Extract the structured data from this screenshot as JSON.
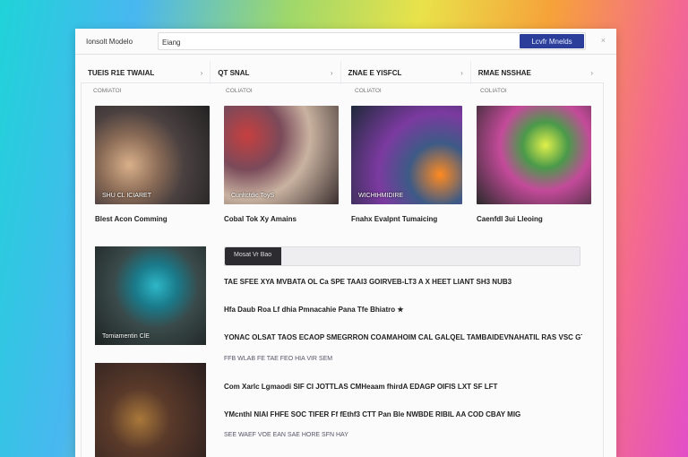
{
  "window": {
    "site_label": "Ionsolt Modelo",
    "site_field": "Eiang",
    "go_button": "Lcvfr Mnelds",
    "close_glyph": "×"
  },
  "chips": [
    {
      "label": "TUEIS R1E TWAIAL"
    },
    {
      "label": "QT SNAL"
    },
    {
      "label": "ZNAE E YISFCL"
    },
    {
      "label": "RMAE NSSHAE"
    }
  ],
  "sections": [
    "COMIATOI",
    "COLIATOI",
    "COLIATOI",
    "COLIATOI"
  ],
  "cards": [
    {
      "overlay": "SHU CL ICIARET",
      "caption": "Blest Acon Comming"
    },
    {
      "overlay": "Cunltctdic ToyS",
      "caption": "Cobal Tok Xy Amains"
    },
    {
      "overlay": "WICHtHMIDIRE",
      "caption": "Fnahx Evalpnt Tumaicing"
    },
    {
      "overlay": "",
      "caption": "Caenfdl 3ui Lleoing"
    }
  ],
  "big_thumbs": [
    {
      "overlay": "Tomiamentin ClE"
    },
    {
      "overlay": ""
    }
  ],
  "progress": {
    "label": "Mosat Vr Bao",
    "value": 0.16
  },
  "rows": [
    {
      "text": "TAE SFEE XYA MVBATA OL Ca SPE TAAI3 GOIRVEB-LT3  A  X  HEET LIANT SH3 NUB3",
      "kind": "bold"
    },
    {
      "text": "Hfa Daub Roa Lf dhia Pmnacahie Pana Tfe Bhiatro  ★",
      "kind": "bold"
    },
    {
      "text": "YONAC OLSAT TAOS ECAOP SMEGRRON COAMAHOIM CAL GALQEL TAMBAIDEVNAHATIL RAS VSC GTK PLS",
      "kind": "bold"
    },
    {
      "text": "FFB WLAB FE TAE FEO HIA VIR SEM",
      "kind": "sub"
    },
    {
      "text": "Com Xarlc Lgmaodi SIF CI JOTTLAS CMHeaam fhirdA  EDAGP OIFIS LXT SF LFT",
      "kind": "bold"
    },
    {
      "text": "YMcnthl NIAI FHFE SOC TIFER Ff fEthf3 CTT Pan Ble  NWBDE RIBIL AA COD CBAY MIG",
      "kind": "bold"
    },
    {
      "text": "SEE WAEF VOE EAN SAE HORE SFN HAY",
      "kind": "sub"
    }
  ],
  "colors": {
    "accent": "#2a3e9a",
    "progress_fill": "#2c2c30",
    "icon_a": "#3e7ac2",
    "icon_b": "#c4222f",
    "icon_c": "#8a9ab0",
    "icon_d": "#c42a5a"
  }
}
